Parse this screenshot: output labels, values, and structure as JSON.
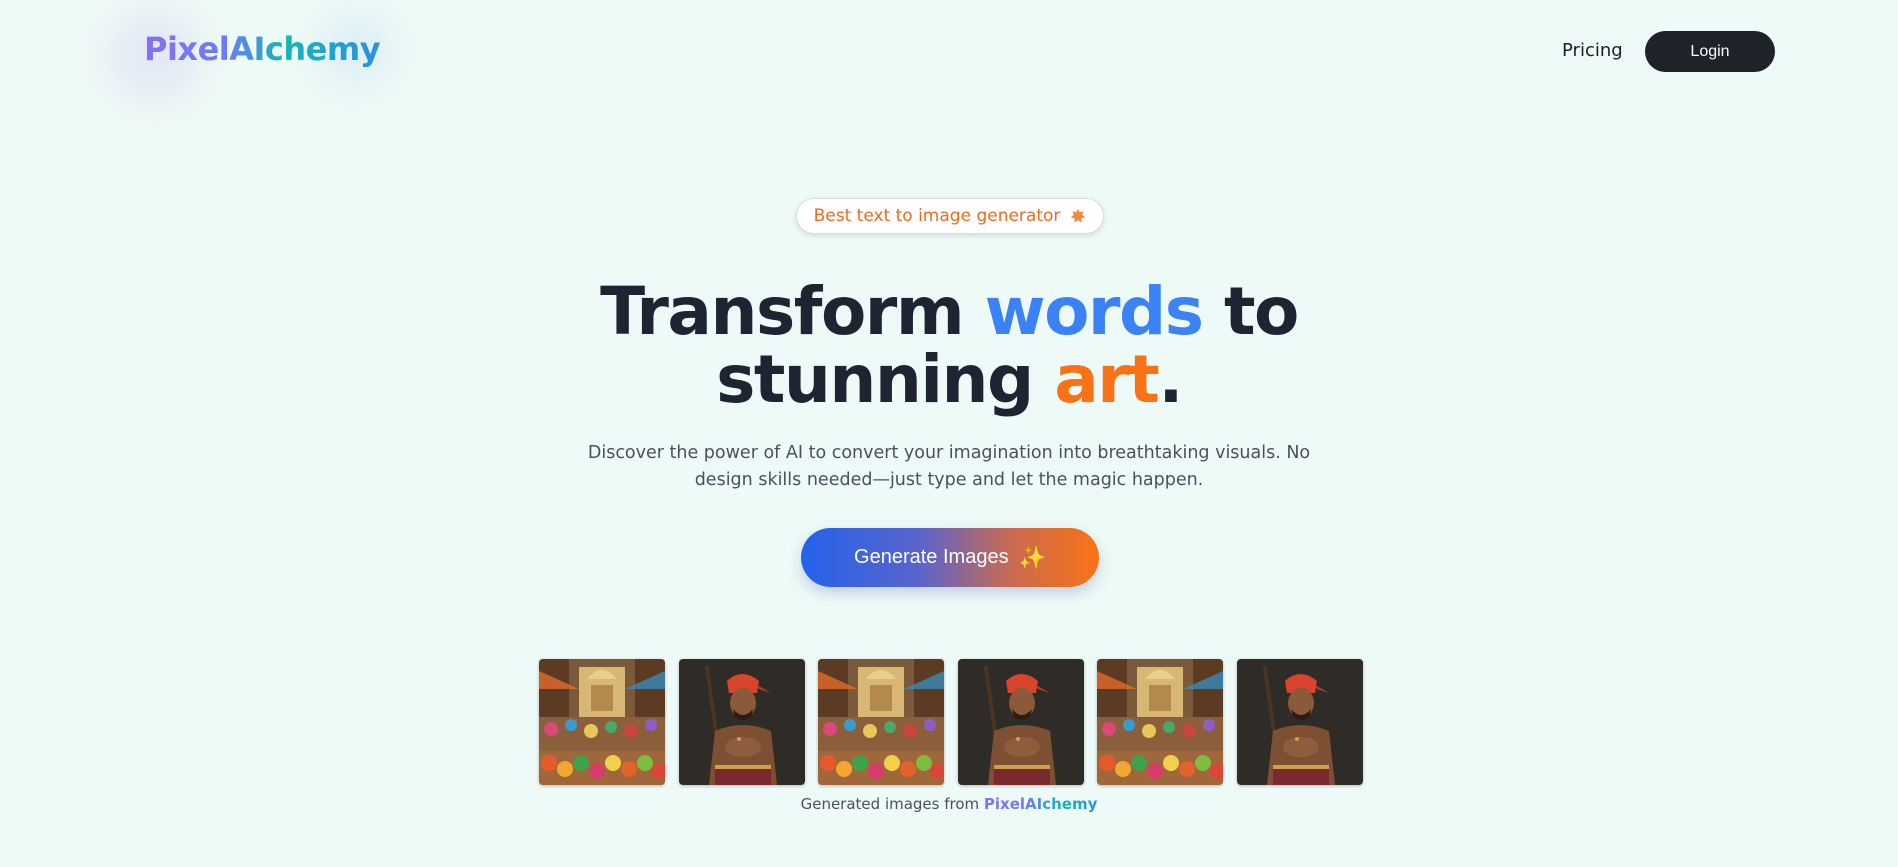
{
  "header": {
    "logo": "PixelAIchemy",
    "nav_pricing": "Pricing",
    "login_label": "Login"
  },
  "hero": {
    "badge": "Best text to image generator",
    "badge_icon": "badge-star-icon",
    "headline_part1": "Transform ",
    "headline_highlight1": "words",
    "headline_part2": " to",
    "headline_part3": "stunning ",
    "headline_highlight2": "art",
    "headline_part4": ".",
    "subtitle": "Discover the power of AI to convert your imagination into breathtaking visuals. No design skills needed—just type and let the magic happen.",
    "cta_label": "Generate Images",
    "cta_icon": "sparkles-icon"
  },
  "gallery": {
    "images": [
      {
        "subject": "market-street-scene"
      },
      {
        "subject": "man-with-red-turban-and-rifle"
      },
      {
        "subject": "market-street-scene"
      },
      {
        "subject": "man-with-red-turban-and-rifle"
      },
      {
        "subject": "market-street-scene"
      },
      {
        "subject": "man-with-red-turban-and-rifle"
      }
    ],
    "caption_prefix": "Generated images from ",
    "caption_brand": "PixelAIchemy"
  },
  "colors": {
    "background": "#eefaf7",
    "accent_blue": "#3b82f6",
    "accent_orange": "#f97316",
    "login_bg": "#1f2228"
  }
}
